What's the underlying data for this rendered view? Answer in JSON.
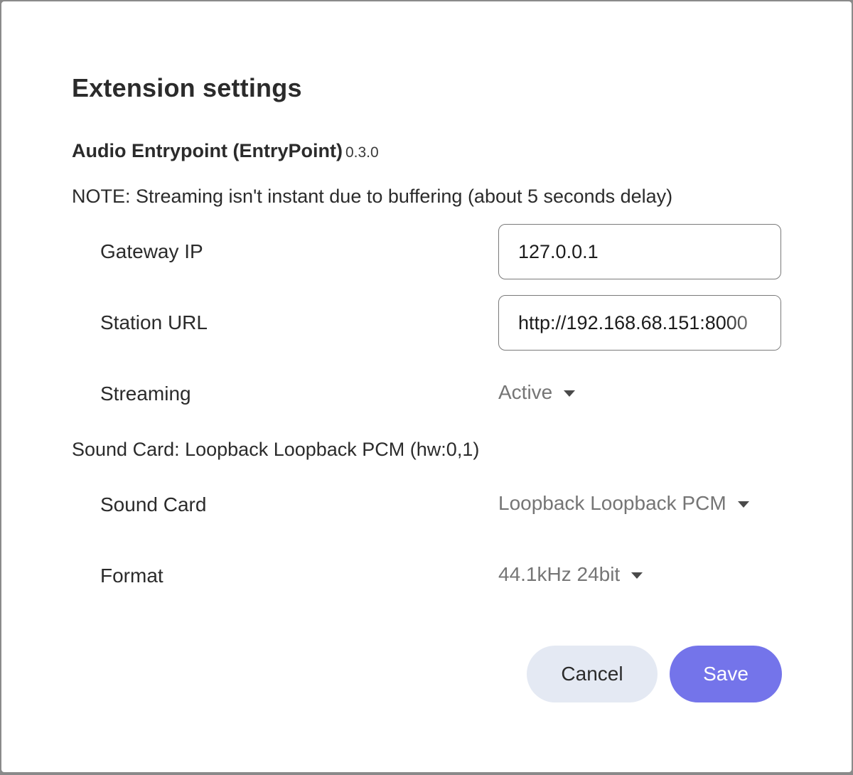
{
  "dialog": {
    "title": "Extension settings",
    "extension_name": "Audio Entrypoint (EntryPoint)",
    "extension_version": "0.3.0",
    "note": "NOTE: Streaming isn't instant due to buffering (about 5 seconds delay)"
  },
  "fields": {
    "gateway_ip": {
      "label": "Gateway IP",
      "value": "127.0.0.1"
    },
    "station_url": {
      "label": "Station URL",
      "value": "http://192.168.68.151:8000"
    },
    "streaming": {
      "label": "Streaming",
      "selected": "Active"
    }
  },
  "sound_card_section": {
    "heading": "Sound Card: Loopback Loopback PCM (hw:0,1)",
    "sound_card": {
      "label": "Sound Card",
      "selected": "Loopback Loopback PCM"
    },
    "format": {
      "label": "Format",
      "selected": "44.1kHz 24bit"
    }
  },
  "buttons": {
    "cancel": "Cancel",
    "save": "Save"
  },
  "colors": {
    "primary": "#7474ea",
    "secondary_button": "#e4e9f3",
    "overlay": "#8a8a8a"
  }
}
